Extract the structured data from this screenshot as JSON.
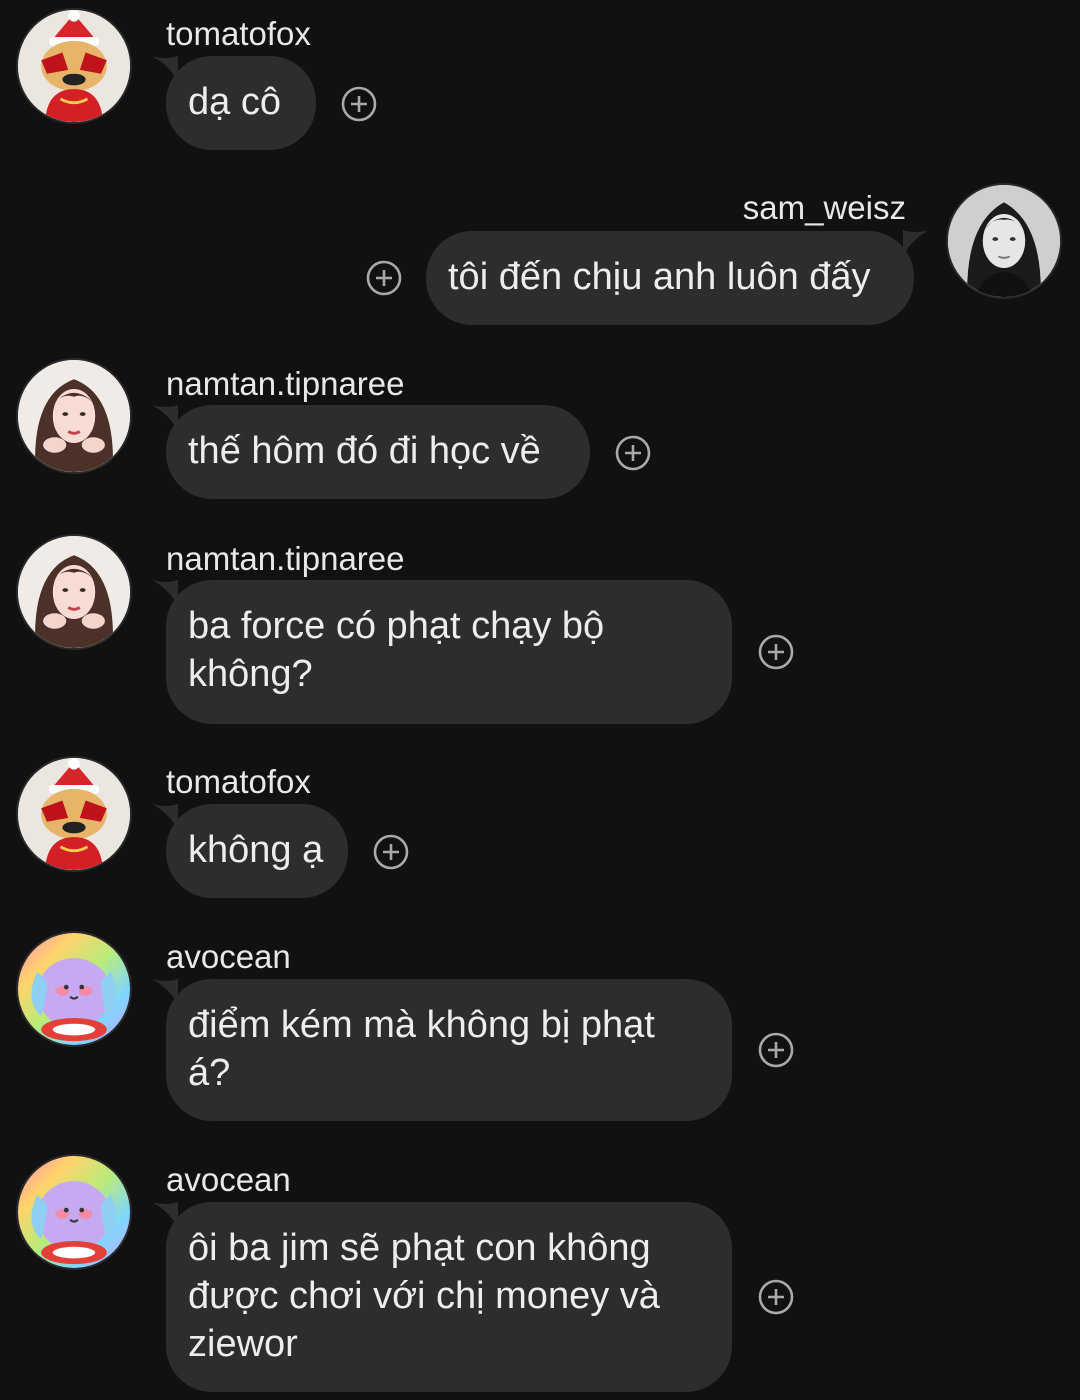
{
  "messages": [
    {
      "user": "tomatofox",
      "text": "dạ cô",
      "side": "left",
      "avatar": "fox-santa-avatar"
    },
    {
      "user": "sam_weisz",
      "text": "tôi đến chịu anh luôn đấy",
      "side": "right",
      "avatar": "woman-portrait-avatar"
    },
    {
      "user": "namtan.tipnaree",
      "text": "thế hôm đó đi học về",
      "side": "left",
      "avatar": "girl-portrait-avatar"
    },
    {
      "user": "namtan.tipnaree",
      "text": "ba force có phạt chạy bộ không?",
      "side": "left",
      "avatar": "girl-portrait-avatar"
    },
    {
      "user": "tomatofox",
      "text": "không ạ",
      "side": "left",
      "avatar": "fox-santa-avatar"
    },
    {
      "user": "avocean",
      "text": "điểm kém mà không bị phạt á?",
      "side": "left",
      "avatar": "rainbow-creature-avatar"
    },
    {
      "user": "avocean",
      "text": "ôi ba jim sẽ phạt con không được chơi với chị money và ziewor",
      "side": "left",
      "avatar": "rainbow-creature-avatar"
    }
  ],
  "icons": {
    "add_reaction": "plus-circle-icon"
  },
  "colors": {
    "background": "#111112",
    "bubble": "#2d2d2f",
    "text": "#ececec",
    "icon": "#a9a9ab"
  }
}
